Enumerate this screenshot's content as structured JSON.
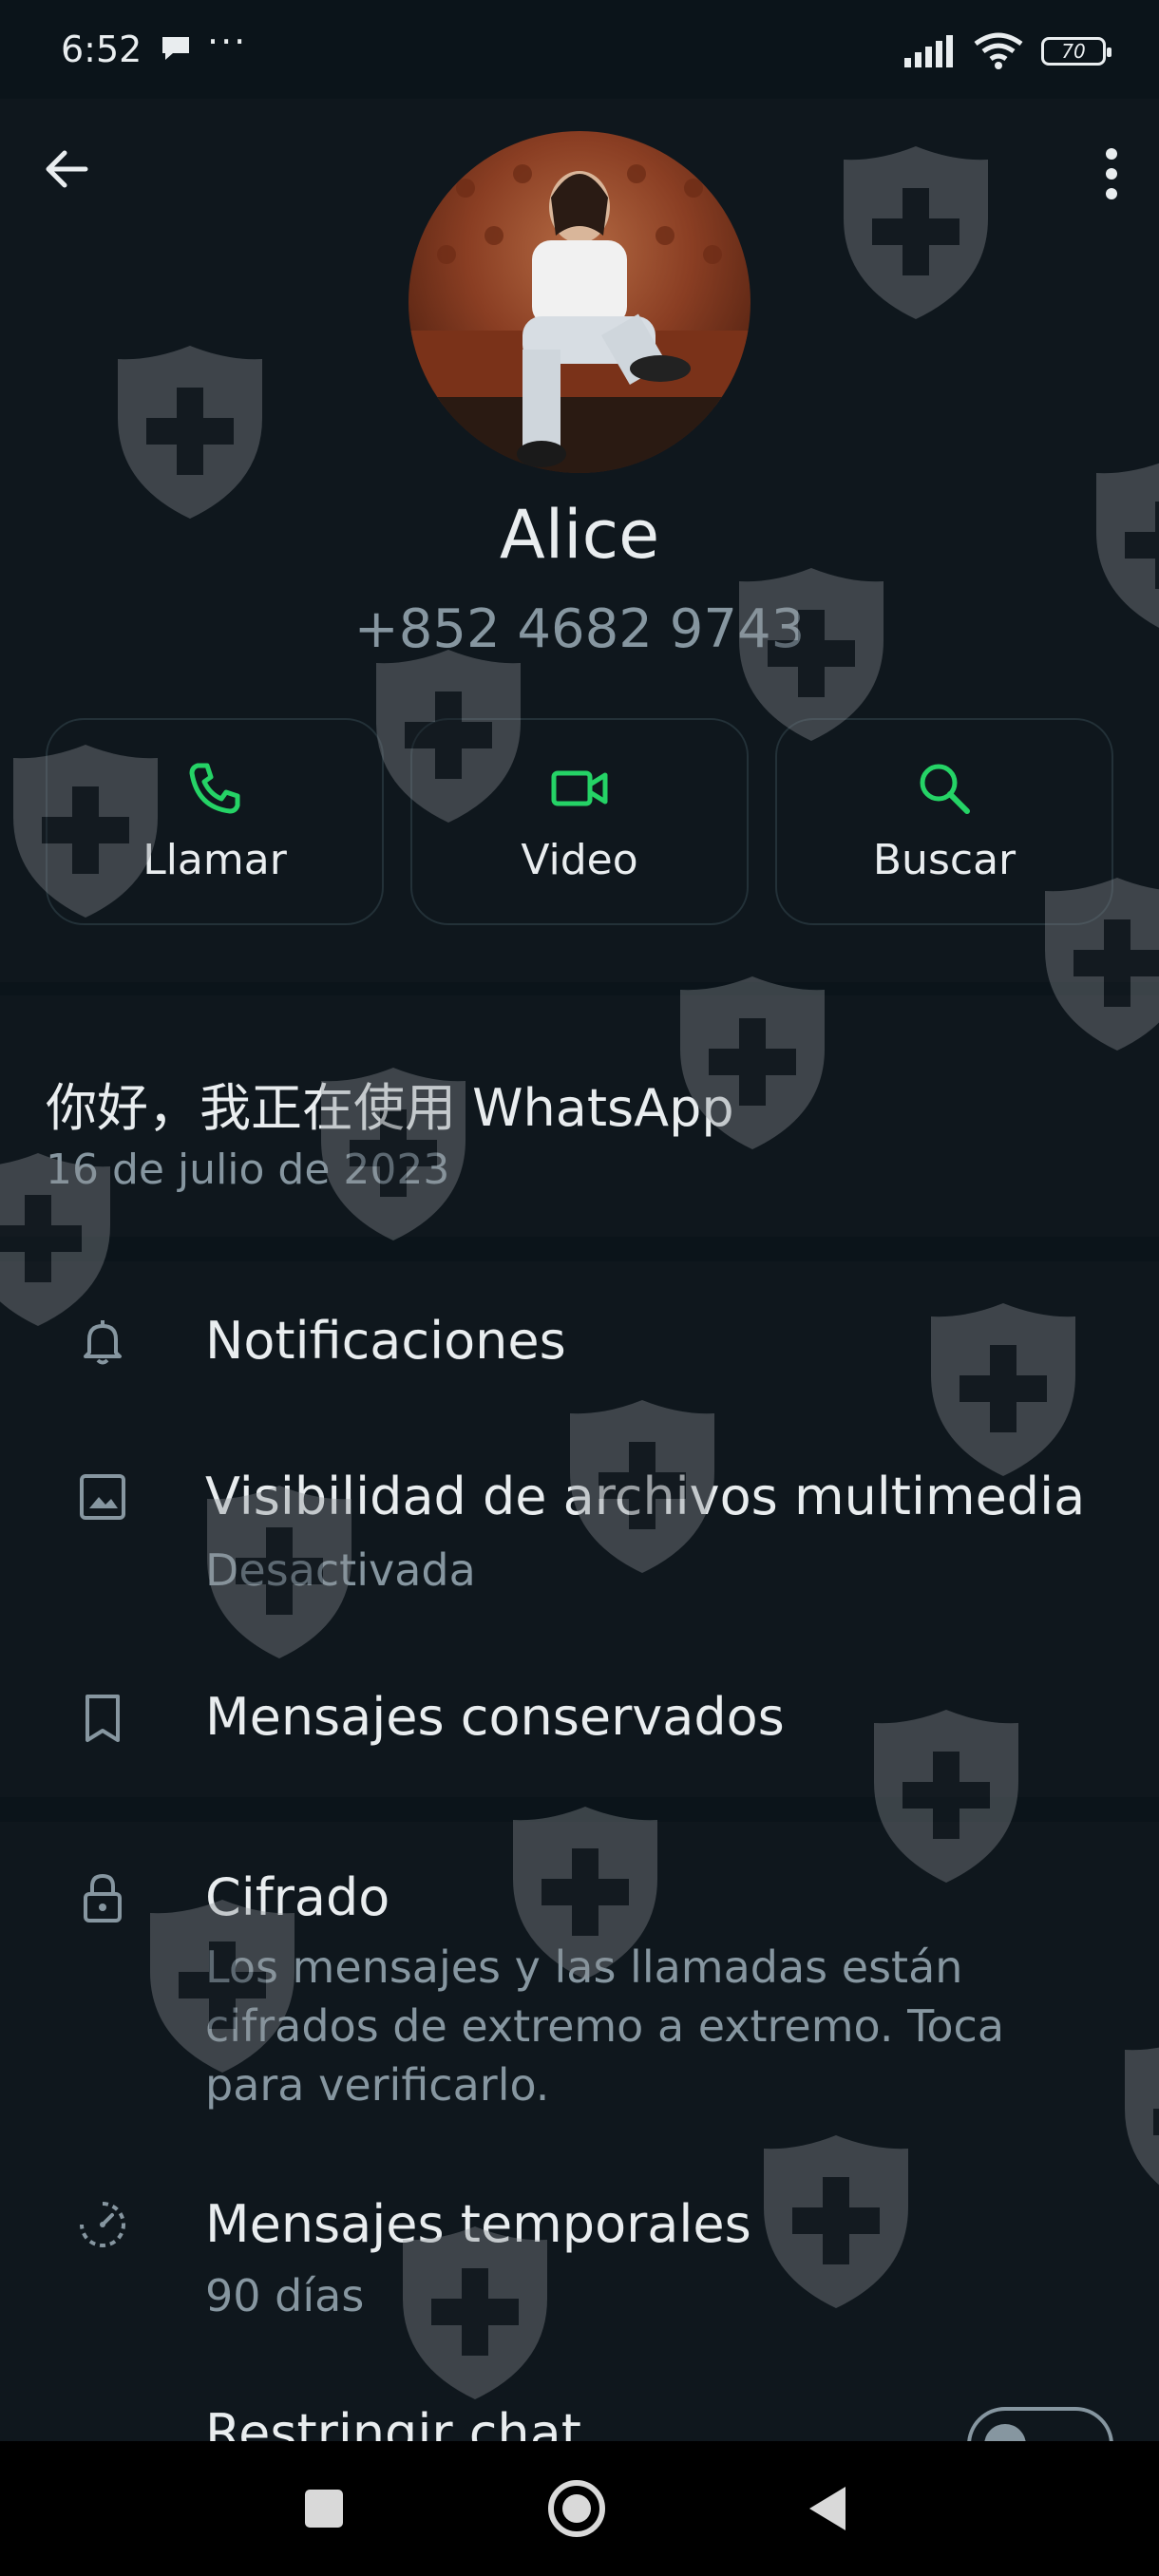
{
  "status_bar": {
    "time": "6:52",
    "dots": "···",
    "battery": "70"
  },
  "contact": {
    "name": "Alice",
    "phone": "+852 4682 9743"
  },
  "actions": [
    {
      "label": "Llamar",
      "icon": "phone-icon"
    },
    {
      "label": "Video",
      "icon": "video-icon"
    },
    {
      "label": "Buscar",
      "icon": "search-icon"
    }
  ],
  "about": {
    "text": "你好，我正在使用 WhatsApp",
    "date": "16 de julio de 2023"
  },
  "settings": {
    "notifications": "Notificaciones",
    "media_visibility": {
      "title": "Visibilidad de archivos multimedia",
      "value": "Desactivada"
    },
    "kept_messages": "Mensajes conservados"
  },
  "security": {
    "encryption": {
      "title": "Cifrado",
      "description": "Los mensajes y las llamadas están cifrados de extremo a extremo. Toca para verificarlo."
    },
    "disappearing": {
      "title": "Mensajes temporales",
      "value": "90 días"
    },
    "restrict_chat": {
      "title": "Restringir chat",
      "enabled": false
    }
  },
  "colors": {
    "accent": "#25d366",
    "background": "#0b141a",
    "surface": "#0f171d",
    "secondary_text": "#8696a0"
  }
}
